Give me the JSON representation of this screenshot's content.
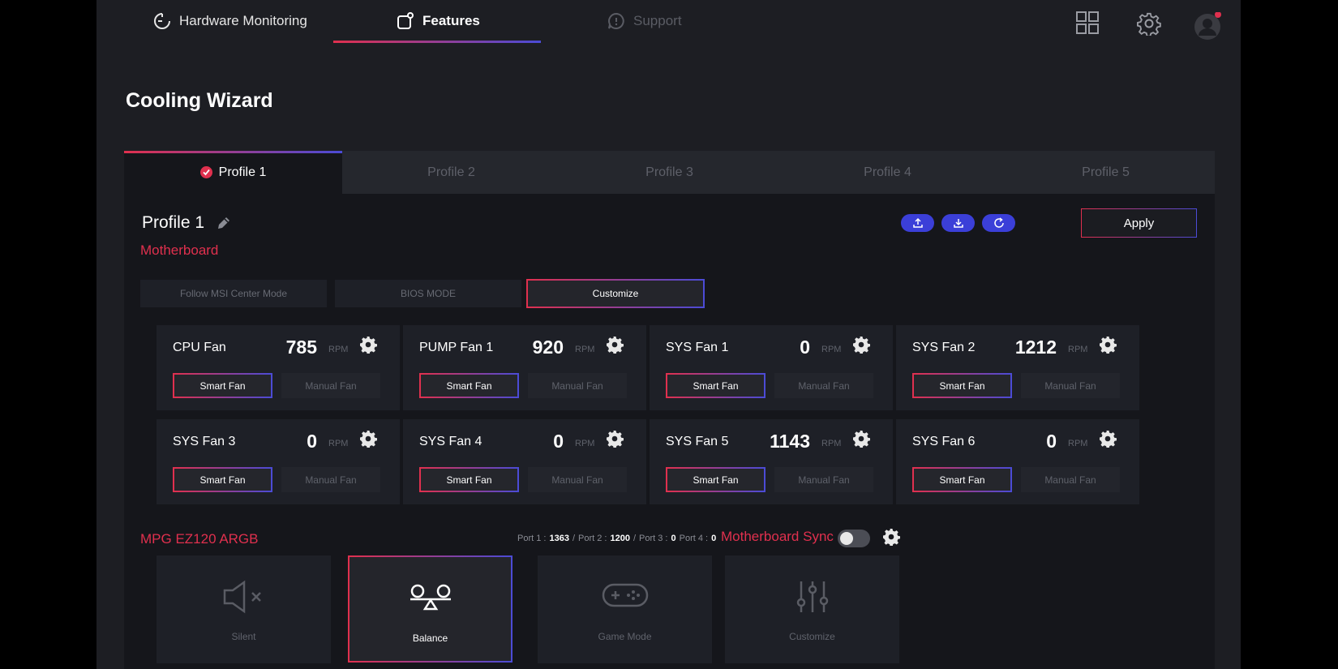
{
  "nav": {
    "hardware_monitoring": "Hardware Monitoring",
    "features": "Features",
    "support": "Support"
  },
  "page": {
    "title": "Cooling Wizard"
  },
  "tabs": [
    {
      "label": "Profile 1",
      "active": true
    },
    {
      "label": "Profile 2",
      "active": false
    },
    {
      "label": "Profile 3",
      "active": false
    },
    {
      "label": "Profile 4",
      "active": false
    },
    {
      "label": "Profile 5",
      "active": false
    }
  ],
  "profile": {
    "name": "Profile 1",
    "apply_label": "Apply"
  },
  "motherboard": {
    "section_label": "Motherboard",
    "modes": [
      "Follow MSI Center Mode",
      "BIOS MODE",
      "Customize"
    ],
    "active_mode": "Customize",
    "fans": [
      {
        "name": "CPU Fan",
        "rpm": "785",
        "unit": "RPM",
        "smart": "Smart Fan",
        "manual": "Manual Fan"
      },
      {
        "name": "PUMP Fan 1",
        "rpm": "920",
        "unit": "RPM",
        "smart": "Smart Fan",
        "manual": "Manual Fan"
      },
      {
        "name": "SYS Fan 1",
        "rpm": "0",
        "unit": "RPM",
        "smart": "Smart Fan",
        "manual": "Manual Fan"
      },
      {
        "name": "SYS Fan 2",
        "rpm": "1212",
        "unit": "RPM",
        "smart": "Smart Fan",
        "manual": "Manual Fan"
      },
      {
        "name": "SYS Fan 3",
        "rpm": "0",
        "unit": "RPM",
        "smart": "Smart Fan",
        "manual": "Manual Fan"
      },
      {
        "name": "SYS Fan 4",
        "rpm": "0",
        "unit": "RPM",
        "smart": "Smart Fan",
        "manual": "Manual Fan"
      },
      {
        "name": "SYS Fan 5",
        "rpm": "1143",
        "unit": "RPM",
        "smart": "Smart Fan",
        "manual": "Manual Fan"
      },
      {
        "name": "SYS Fan 6",
        "rpm": "0",
        "unit": "RPM",
        "smart": "Smart Fan",
        "manual": "Manual Fan"
      }
    ]
  },
  "argb": {
    "section_label": "MPG EZ120 ARGB",
    "ports": [
      {
        "label": "Port 1 :",
        "value": "1363"
      },
      {
        "label": "Port 2 :",
        "value": "1200"
      },
      {
        "label": "Port 3 :",
        "value": "0"
      },
      {
        "label": "Port 4 :",
        "value": "0"
      }
    ],
    "sync_label": "Motherboard Sync",
    "sync_enabled": false,
    "modes": [
      {
        "label": "Silent",
        "icon": "speaker-mute-icon"
      },
      {
        "label": "Balance",
        "icon": "balance-icon"
      },
      {
        "label": "Game Mode",
        "icon": "gamepad-icon"
      },
      {
        "label": "Customize",
        "icon": "sliders-icon"
      }
    ],
    "active_mode": "Balance"
  },
  "colors": {
    "accent_red": "#e0304e",
    "accent_blue": "#3b3fd8",
    "background": "#1d1e23",
    "panel": "#15161b"
  }
}
